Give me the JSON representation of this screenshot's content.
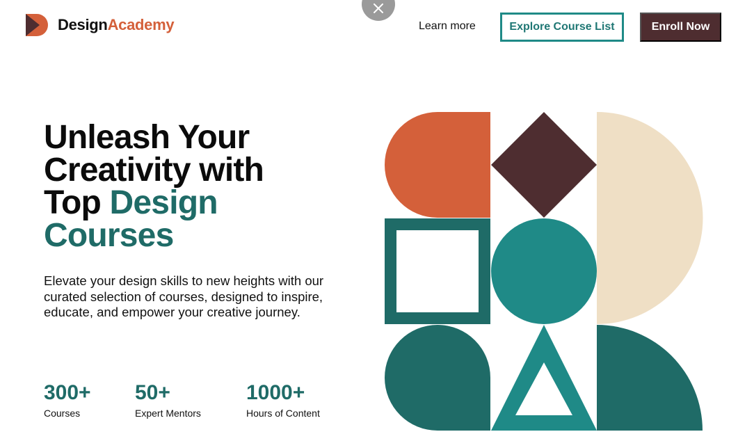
{
  "brand": {
    "name_part1": "Design",
    "name_part2": "Academy",
    "logo_icon": "play-triangle-logo-icon",
    "colors": {
      "primary_text": "#111111",
      "orange": "#d4603a",
      "teal": "#1f8a87",
      "dark_teal": "#1f6b67",
      "maroon": "#4e2d30",
      "cream": "#efdfc5"
    }
  },
  "header": {
    "close_icon": "close-icon",
    "learn_more": "Learn more",
    "explore_button": "Explore Course List",
    "enroll_button": "Enroll Now"
  },
  "hero": {
    "title_line1": "Unleash Your",
    "title_line2": "Creativity with",
    "title_line3_plain": "Top ",
    "title_line3_accent": "Design",
    "title_line4_accent": "Courses",
    "subtitle": "Elevate your design skills to new heights with our curated selection of courses, designed to inspire, educate, and empower your creative journey."
  },
  "stats": [
    {
      "number": "300+",
      "label": "Courses"
    },
    {
      "number": "50+",
      "label": "Expert Mentors"
    },
    {
      "number": "1000+",
      "label": "Hours of Content"
    }
  ]
}
